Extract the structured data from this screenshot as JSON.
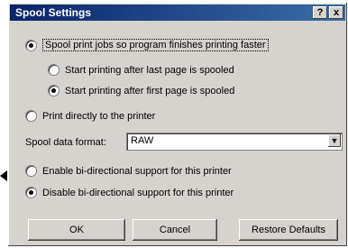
{
  "window": {
    "title": "Spool Settings"
  },
  "title_buttons": {
    "help": "?",
    "close": "x"
  },
  "options": {
    "spool": "Spool print jobs so program finishes printing faster",
    "start_after_last": "Start printing after last page is spooled",
    "start_after_first": "Start printing after first page is spooled",
    "print_direct": "Print directly to the printer"
  },
  "format": {
    "label": "Spool data format:",
    "value": "RAW"
  },
  "bidi": {
    "enable": "Enable bi-directional support for this printer",
    "disable": "Disable bi-directional support for this printer"
  },
  "buttons": {
    "ok": "OK",
    "cancel": "Cancel",
    "restore": "Restore Defaults"
  }
}
